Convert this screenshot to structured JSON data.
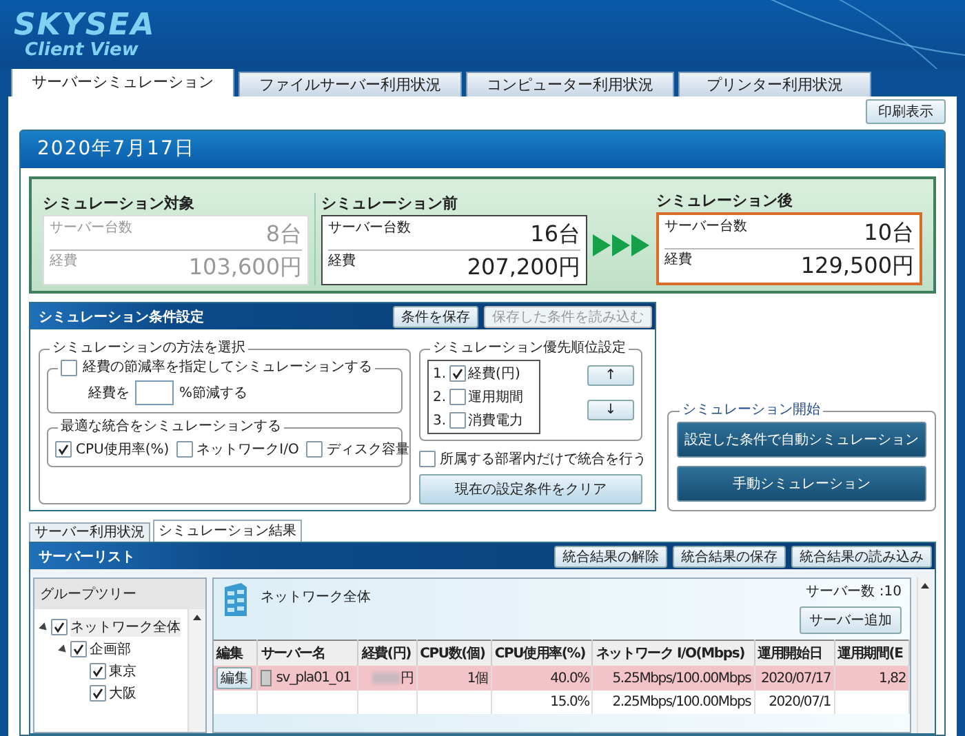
{
  "logo": {
    "line_1": "SKYSEA",
    "line_2": "Client View"
  },
  "tabs": [
    {
      "label": "サーバーシミュレーション",
      "selected": true
    },
    {
      "label": "ファイルサーバー利用状況",
      "selected": false
    },
    {
      "label": "コンピューター利用状況",
      "selected": false
    },
    {
      "label": "プリンター利用状況",
      "selected": false
    }
  ],
  "print_button": "印刷表示",
  "date": "2020年7月17日",
  "summary": {
    "cards": [
      {
        "title": "シミュレーション対象",
        "kind": "muted",
        "servers_label": "サーバー台数",
        "servers": "8台",
        "cost_label": "経費",
        "cost": "103,600円"
      },
      {
        "title": "シミュレーション前",
        "kind": "before",
        "servers_label": "サーバー台数",
        "servers": "16台",
        "cost_label": "経費",
        "cost": "207,200円"
      },
      {
        "title": "シミュレーション後",
        "kind": "after",
        "servers_label": "サーバー台数",
        "servers": "10台",
        "cost_label": "経費",
        "cost": "129,500円"
      }
    ]
  },
  "conditions": {
    "title": "シミュレーション条件設定",
    "buttons": [
      {
        "label": "条件を保存",
        "disabled": false
      },
      {
        "label": "保存した条件を読み込む",
        "disabled": true
      }
    ],
    "method_group": {
      "title": "シミュレーションの方法を選択",
      "reduction": {
        "label": "経費の節減率を指定してシミュレーションする",
        "checked": false,
        "prefix": "経費を",
        "suffix": "%節減する"
      },
      "optimal": {
        "title": "最適な統合をシミュレーションする",
        "options": [
          {
            "label": "CPU使用率(%)",
            "checked": true
          },
          {
            "label": "ネットワークI/O",
            "checked": false
          },
          {
            "label": "ディスク容量",
            "checked": false
          }
        ]
      }
    },
    "priority_group": {
      "title": "シミュレーション優先順位設定",
      "items": [
        {
          "number": "1.",
          "label": "経費(円)",
          "checked": true
        },
        {
          "number": "2.",
          "label": "運用期間",
          "checked": false
        },
        {
          "number": "3.",
          "label": "消費電力",
          "checked": false
        }
      ],
      "up": "↑",
      "down": "↓"
    },
    "department_only": {
      "label": "所属する部署内だけで統合を行う",
      "checked": false
    },
    "clear_button": "現在の設定条件をクリア"
  },
  "start_group": {
    "title": "シミュレーション開始",
    "buttons": [
      "設定した条件で自動シミュレーション",
      "手動シミュレーション"
    ]
  },
  "bottom_tabs": [
    {
      "label": "サーバー利用状況",
      "selected": false
    },
    {
      "label": "シミュレーション結果",
      "selected": true
    }
  ],
  "server_list": {
    "title": "サーバーリスト",
    "buttons": [
      "統合結果の解除",
      "統合結果の保存",
      "統合結果の読み込み"
    ],
    "tree": {
      "title": "グループツリー",
      "nodes": [
        {
          "label": "ネットワーク全体",
          "checked": true,
          "expanded": true,
          "selected": true,
          "children": [
            {
              "label": "企画部",
              "checked": true,
              "expanded": true,
              "selected": false,
              "children": [
                {
                  "label": "東京",
                  "checked": true,
                  "selected": false
                },
                {
                  "label": "大阪",
                  "checked": true,
                  "selected": false
                }
              ]
            }
          ]
        }
      ]
    },
    "group_name": "ネットワーク全体",
    "server_count": "サーバー数 :10",
    "add_button": "サーバー追加",
    "columns": [
      "編集",
      "サーバー名",
      "経費(円)",
      "CPU数(個)",
      "CPU使用率(%)",
      "ネットワーク I/O(Mbps)",
      "運用開始日",
      "運用期間(E"
    ],
    "rows": [
      {
        "highlighted": true,
        "edit": "編集",
        "server": "sv_pla01_01",
        "cost": "円",
        "cpu_count": "1個",
        "cpu_usage": "40.0%",
        "network": "5.25Mbps/100.00Mbps",
        "start_date": "2020/07/17",
        "period": "1,82"
      },
      {
        "highlighted": false,
        "cpu_usage": "15.0%",
        "network": "2.25Mbps/100.00Mbps",
        "start_date": "2020/07/1"
      }
    ]
  }
}
